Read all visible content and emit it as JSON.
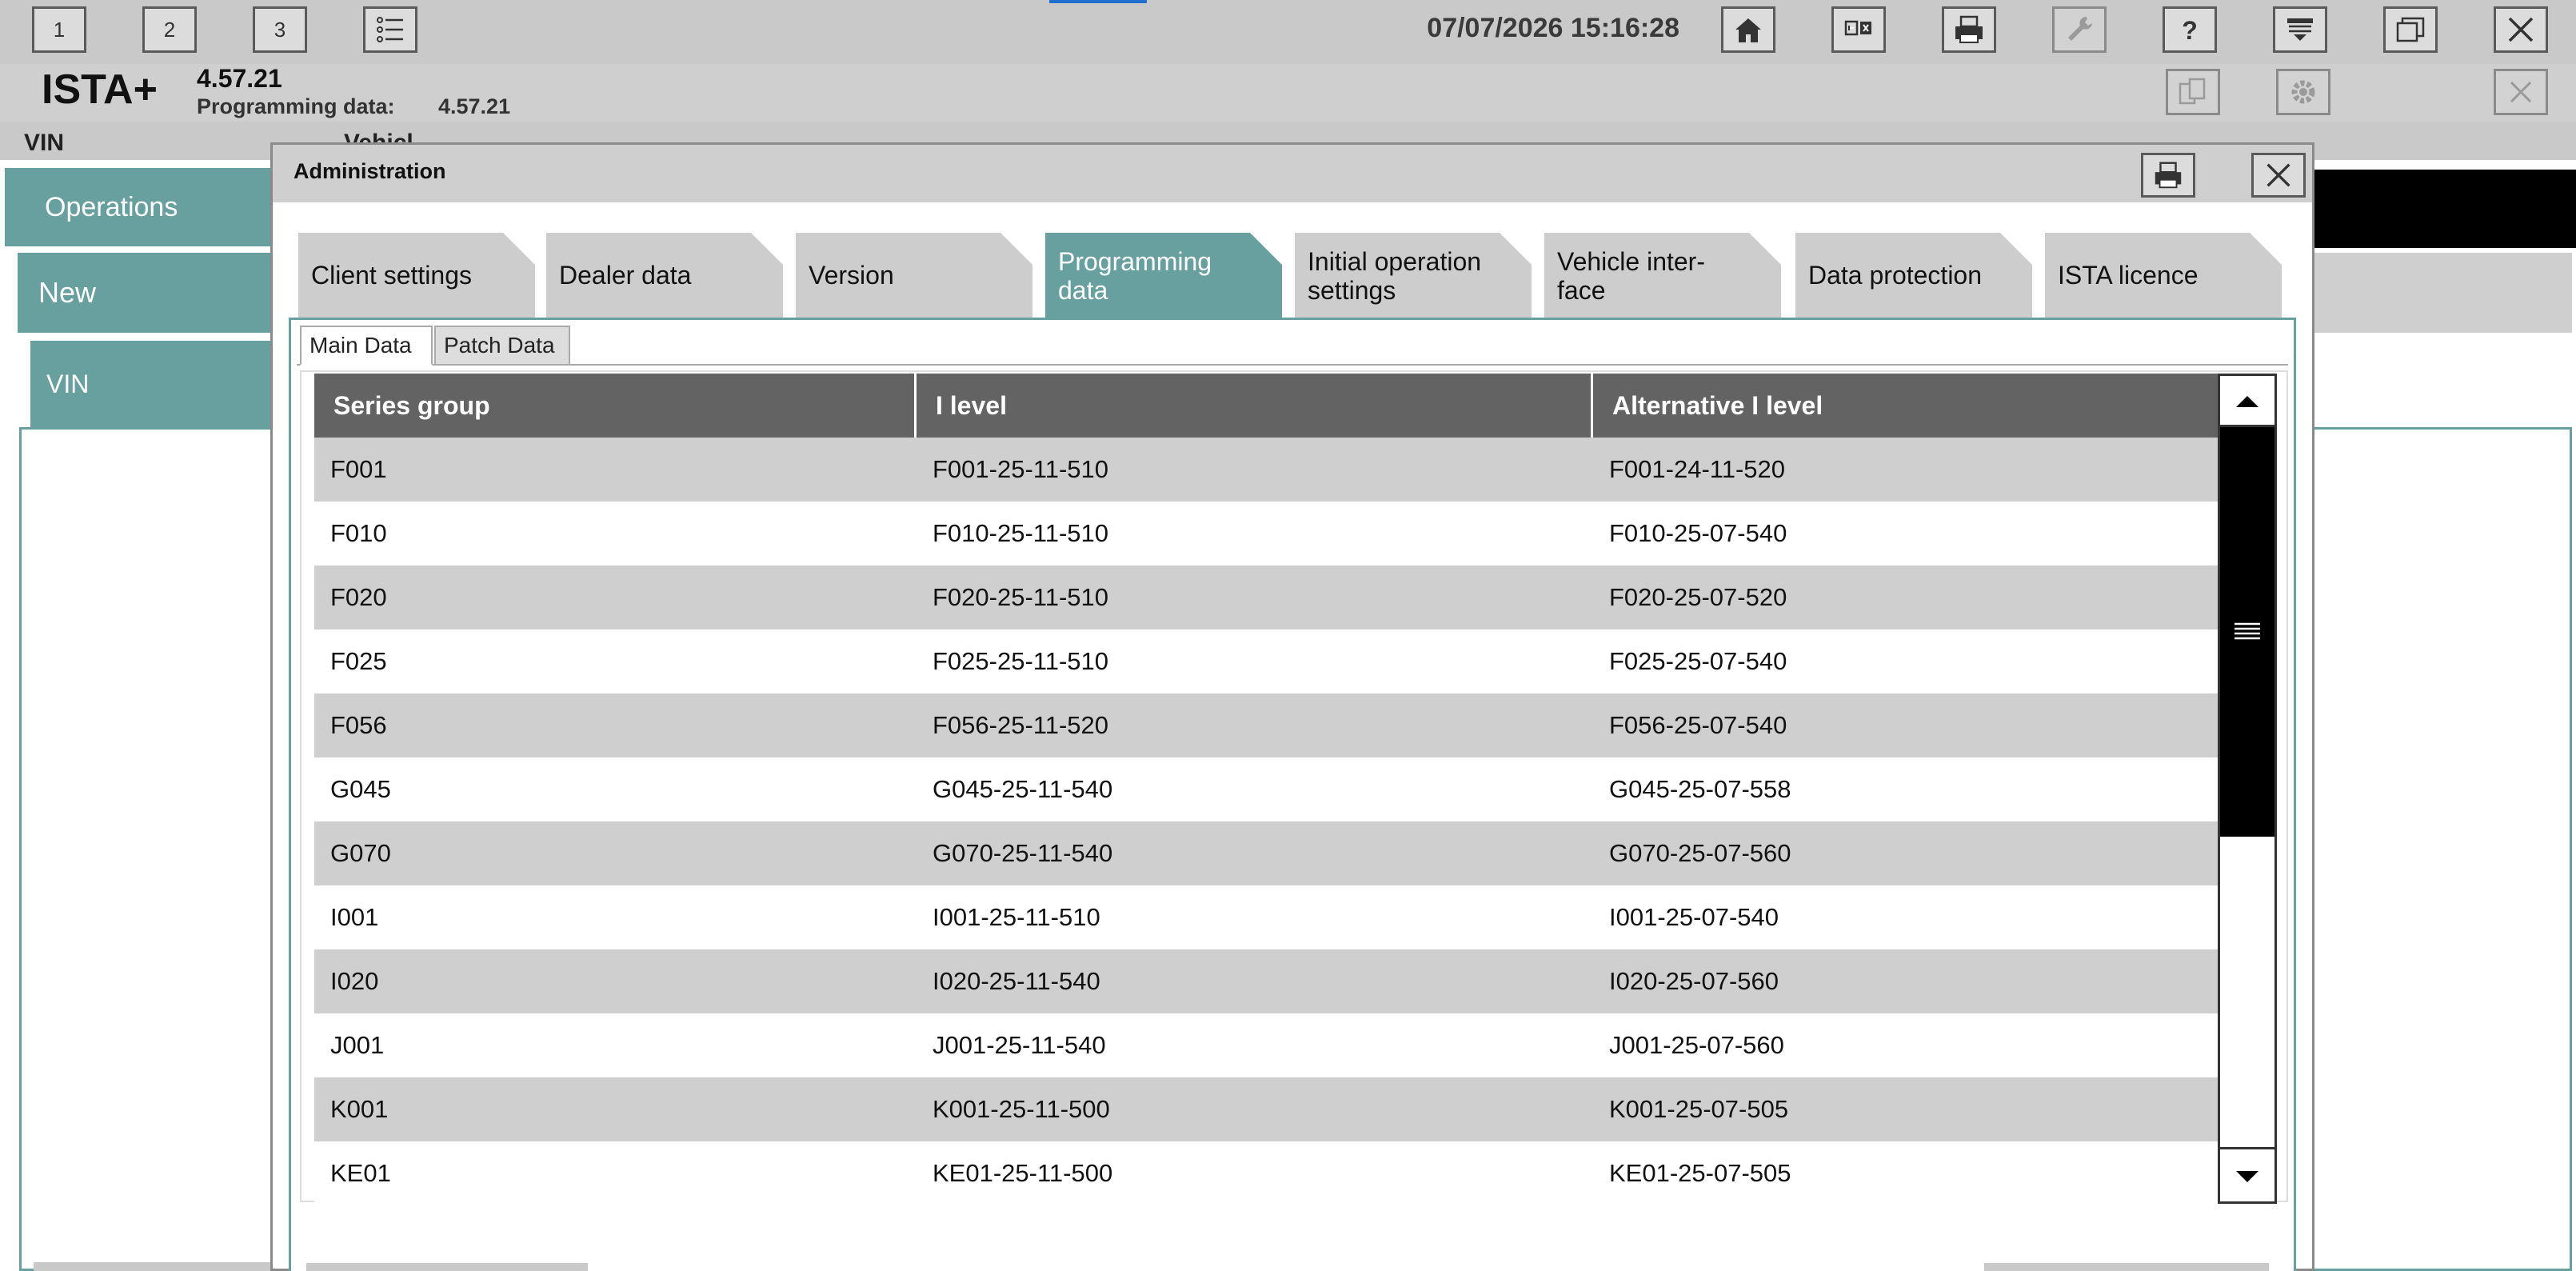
{
  "toolbar": {
    "screen_buttons": [
      "1",
      "2",
      "3"
    ],
    "datetime": "07/07/2026 15:16:28",
    "icons": [
      "list-icon",
      "home-icon",
      "compare-icon",
      "print-icon",
      "wrench-icon",
      "help-icon",
      "dropdown-panel-icon",
      "window-icon",
      "close-icon"
    ]
  },
  "header": {
    "app_title": "ISTA+",
    "version": "4.57.21",
    "programming_data_label": "Programming data:",
    "programming_data_value": "4.57.21",
    "icons": [
      "copy-icon",
      "gear-icon",
      "close-icon"
    ]
  },
  "background": {
    "vin_label": "VIN",
    "vehicle_label": "Vehicl",
    "tabs": {
      "operations": "Operations",
      "new": "New",
      "vin": "VIN"
    }
  },
  "dialog": {
    "title": "Administration",
    "icons": [
      "print-icon",
      "close-icon"
    ],
    "tabs": [
      {
        "label": "Client settings",
        "active": false
      },
      {
        "label": "Dealer data",
        "active": false
      },
      {
        "label": "Version",
        "active": false
      },
      {
        "label": "Programming\ndata",
        "active": true
      },
      {
        "label": "Initial operation\nsettings",
        "active": false
      },
      {
        "label": "Vehicle inter-\nface",
        "active": false
      },
      {
        "label": "Data protection",
        "active": false
      },
      {
        "label": "ISTA licence",
        "active": false
      }
    ],
    "subtabs": [
      {
        "label": "Main Data",
        "active": true
      },
      {
        "label": "Patch Data",
        "active": false
      }
    ],
    "table": {
      "columns": [
        "Series group",
        "I level",
        "Alternative I level"
      ],
      "rows": [
        [
          "F001",
          "F001-25-11-510",
          "F001-24-11-520"
        ],
        [
          "F010",
          "F010-25-11-510",
          "F010-25-07-540"
        ],
        [
          "F020",
          "F020-25-11-510",
          "F020-25-07-520"
        ],
        [
          "F025",
          "F025-25-11-510",
          "F025-25-07-540"
        ],
        [
          "F056",
          "F056-25-11-520",
          "F056-25-07-540"
        ],
        [
          "G045",
          "G045-25-11-540",
          "G045-25-07-558"
        ],
        [
          "G070",
          "G070-25-11-540",
          "G070-25-07-560"
        ],
        [
          "I001",
          "I001-25-11-510",
          "I001-25-07-540"
        ],
        [
          "I020",
          "I020-25-11-540",
          "I020-25-07-560"
        ],
        [
          "J001",
          "J001-25-11-540",
          "J001-25-07-560"
        ],
        [
          "K001",
          "K001-25-11-500",
          "K001-25-07-505"
        ],
        [
          "KE01",
          "KE01-25-11-500",
          "KE01-25-07-505"
        ]
      ]
    },
    "scrollbar_icons": [
      "arrow-up-icon",
      "grip-icon",
      "arrow-down-icon"
    ]
  },
  "colors": {
    "accent": "#68a0a0",
    "header_gray": "#636363",
    "row_alt": "#cfcfcf",
    "toolbar": "#c9c9c9"
  }
}
